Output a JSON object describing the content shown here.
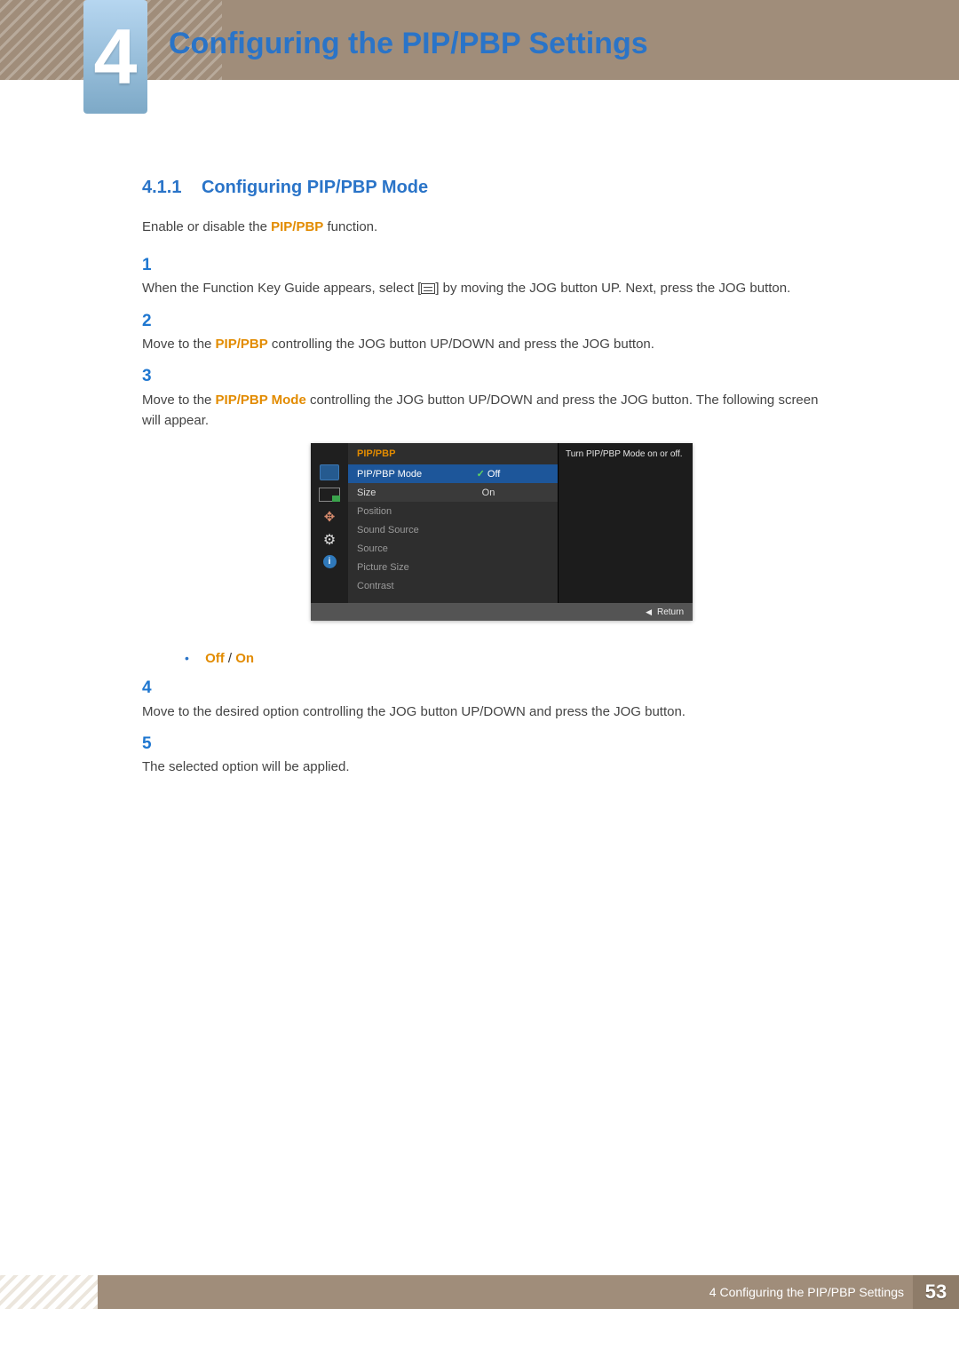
{
  "chapter": {
    "number": "4",
    "title": "Configuring the PIP/PBP Settings"
  },
  "section": {
    "number": "4.1.1",
    "title": "Configuring PIP/PBP Mode"
  },
  "intro": {
    "a": "Enable or disable the ",
    "hl": "PIP/PBP",
    "b": " function."
  },
  "steps": {
    "s1": {
      "num": "1",
      "a": "When the Function Key Guide appears, select [",
      "b": "] by moving the JOG button UP. Next, press the JOG button."
    },
    "s2": {
      "num": "2",
      "a": "Move to the ",
      "hl": "PIP/PBP",
      "b": " controlling the JOG button UP/DOWN and press the JOG button."
    },
    "s3": {
      "num": "3",
      "a": "Move to the ",
      "hl": "PIP/PBP Mode",
      "b": " controlling the JOG button UP/DOWN and press the JOG button. The following screen will appear."
    },
    "s4": {
      "num": "4",
      "text": "Move to the desired option controlling the JOG button UP/DOWN and press the JOG button."
    },
    "s5": {
      "num": "5",
      "text": "The selected option will be applied."
    }
  },
  "options": {
    "off": "Off",
    "sep": " / ",
    "on": "On"
  },
  "osd": {
    "heading": "PIP/PBP",
    "rows": {
      "mode": {
        "label": "PIP/PBP Mode",
        "val": "Off"
      },
      "size": {
        "label": "Size",
        "val": "On"
      },
      "pos": {
        "label": "Position"
      },
      "sound": {
        "label": "Sound Source"
      },
      "source": {
        "label": "Source"
      },
      "psize": {
        "label": "Picture Size"
      },
      "contrast": {
        "label": "Contrast"
      }
    },
    "tip": "Turn PIP/PBP Mode on or off.",
    "return": "Return"
  },
  "footer": {
    "label": "4 Configuring the PIP/PBP Settings",
    "page": "53"
  }
}
